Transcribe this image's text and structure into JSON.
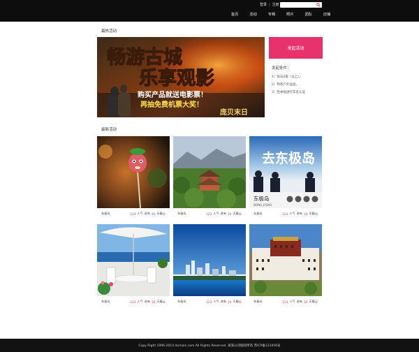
{
  "header": {
    "login": "登录",
    "separator": "|",
    "register": "注册",
    "search": {
      "placeholder": "",
      "value": ""
    },
    "nav": [
      "首页",
      "活动",
      "专辑",
      "照片",
      "团队",
      "店铺"
    ]
  },
  "hot": {
    "section_title": "最热活动",
    "banner": {
      "line1": "畅游古城",
      "line2": "乐享观影",
      "line3": "购买产品就送电影票！",
      "line4": "再抽免费机票大奖！",
      "film": "庞贝末日"
    },
    "promo_button": "发起活动",
    "conditions_title": "发起条件：",
    "conditions": [
      "1）会员2级（以上）。",
      "2）熟悉户外运动。",
      "3）社本站进行实名认证"
    ]
  },
  "latest": {
    "section_title": "最新活动",
    "cards": [
      {
        "name": "东极岛",
        "count": "123",
        "popularity": "人气",
        "ongoing": "进有",
        "days": "20",
        "ending": "天截止",
        "overlay_title": "",
        "overlay_sub": ""
      },
      {
        "name": "东极岛",
        "count": "123",
        "popularity": "人气",
        "ongoing": "进有",
        "days": "20",
        "ending": "天截止",
        "overlay_title": "",
        "overlay_sub": ""
      },
      {
        "name": "东极岛",
        "count": "123",
        "popularity": "人气",
        "ongoing": "进有",
        "days": "20",
        "ending": "天截止",
        "overlay_title": "东极岛",
        "overlay_sub": "DONG JI DAO",
        "headline": "去东极岛"
      },
      {
        "name": "东极岛",
        "count": "123",
        "popularity": "人气",
        "ongoing": "进有",
        "days": "20",
        "ending": "天截止",
        "overlay_title": "",
        "overlay_sub": ""
      },
      {
        "name": "东极岛",
        "count": "123",
        "popularity": "人气",
        "ongoing": "进有",
        "days": "20",
        "ending": "天截止",
        "overlay_title": "",
        "overlay_sub": ""
      },
      {
        "name": "东极岛",
        "count": "123",
        "popularity": "人气",
        "ongoing": "进有",
        "days": "20",
        "ending": "天截止",
        "overlay_title": "",
        "overlay_sub": ""
      }
    ]
  },
  "footer": {
    "text": "Copy Right 1996-2014 domain.com All Rights Reserved. 某某公司版权所有 苏ICP备123456号"
  },
  "colors": {
    "accent": "#e8326d",
    "topbar": "#0d0d0d",
    "background": "#121212"
  },
  "icons": [
    "search-icon",
    "share-icon",
    "comment-icon",
    "phone-icon",
    "mail-icon"
  ]
}
